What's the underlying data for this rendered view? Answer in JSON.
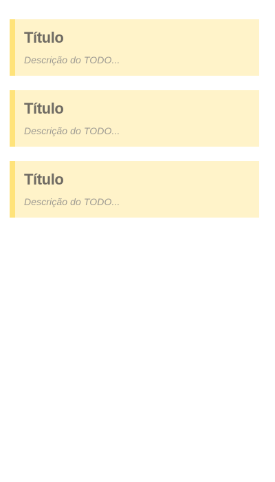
{
  "todos": [
    {
      "title": "Título",
      "description": "Descrição do TODO..."
    },
    {
      "title": "Título",
      "description": "Descrição do TODO..."
    },
    {
      "title": "Título",
      "description": "Descrição do TODO..."
    }
  ],
  "colors": {
    "card_background": "#fff3c9",
    "card_accent": "#ffe37a",
    "title_text": "#6f6b63",
    "description_text": "#9d9a92"
  }
}
